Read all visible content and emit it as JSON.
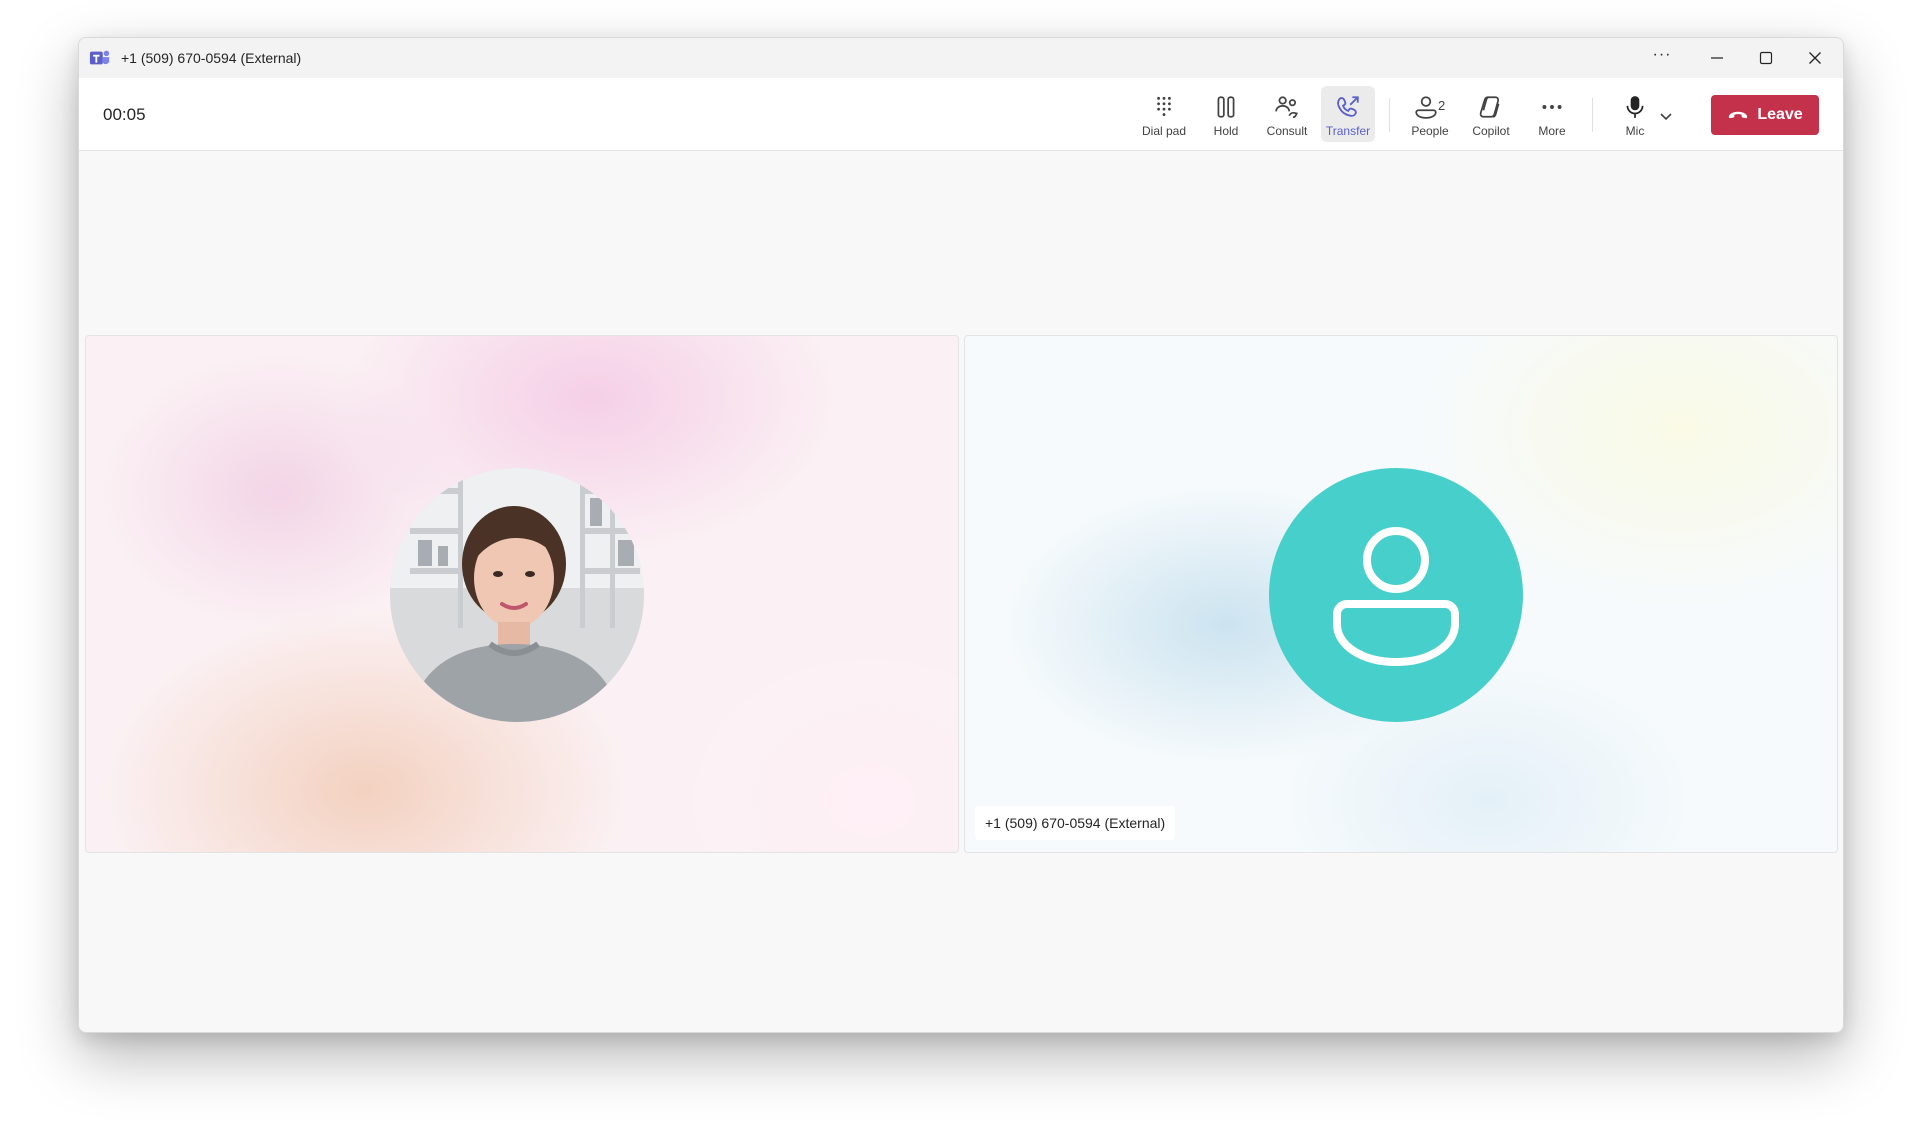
{
  "window": {
    "title": "+1 (509) 670-0594 (External)"
  },
  "titlebar": {
    "more_glyph": "···",
    "app_icon": "teams-icon",
    "minimize_icon": "minimize-icon",
    "maximize_icon": "maximize-icon",
    "close_icon": "close-icon"
  },
  "call": {
    "timer": "00:05"
  },
  "toolbar": {
    "dial_pad": "Dial pad",
    "hold": "Hold",
    "consult": "Consult",
    "transfer": "Transfer",
    "people": "People",
    "people_count": "2",
    "copilot": "Copilot",
    "more": "More",
    "mic": "Mic",
    "leave": "Leave"
  },
  "participants": [
    {
      "avatar": "photo"
    },
    {
      "avatar": "generic-person-icon",
      "name_tag": "+1 (509) 670-0594 (External)"
    }
  ],
  "colors": {
    "accent": "#5b5fc7",
    "leave_red": "#c4314b",
    "avatar_teal": "#47cfcb"
  }
}
